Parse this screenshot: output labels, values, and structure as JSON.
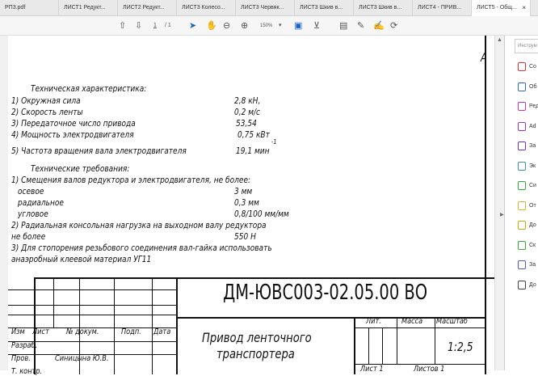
{
  "tabs": [
    "РП3.pdf",
    "ЛИСТ1 Редукт...",
    "ЛИСТ2 Редукт...",
    "ЛИСТ3 Колесо...",
    "ЛИСТ3 Червяк...",
    "ЛИСТ3 Шкив в...",
    "ЛИСТ3 Шкив в...",
    "ЛИСТ4 - ПРИВ...",
    "ЛИСТ5 - Общ..."
  ],
  "toolbar": {
    "page": "1",
    "total": "/ 1",
    "zoom": "150%"
  },
  "panel": {
    "search_placeholder": "Инструм",
    "tools": [
      "Со",
      "Об",
      "Ред",
      "Ad",
      "За",
      "Эк",
      "Си",
      "От",
      "До",
      "Ск",
      "За",
      "До"
    ],
    "tool_colors": [
      "#d33",
      "#36c",
      "#c3a",
      "#93c",
      "#63c",
      "#399",
      "#3a3",
      "#cb2",
      "#ca0",
      "#3a3",
      "#55c",
      "#444"
    ]
  },
  "doc": {
    "corner": "А",
    "tech_title": "Техническая характеристика:",
    "specs": [
      [
        "1) Окружная сила",
        "2,8 кН,"
      ],
      [
        "2) Скорость ленты",
        "0,2 м/с"
      ],
      [
        "3) Передаточное число привода",
        "53,54"
      ],
      [
        "4) Мощность электродвигателя",
        "0,75 кВт"
      ],
      [
        "5) Частота вращения вала электродвигателя",
        "19,1 мин"
      ]
    ],
    "exp": "-1",
    "req_title": "Технические требования:",
    "req": [
      [
        "1) Смещения валов редуктора и электродвигателя, не более:",
        ""
      ],
      [
        "осевое",
        "3 мм"
      ],
      [
        "радиальное",
        "0,3 мм"
      ],
      [
        "угловое",
        "0,8/100 мм/мм"
      ],
      [
        "2) Радиальная консольная нагрузка на выходном валу редуктора",
        ""
      ],
      [
        "не более",
        "550 Н"
      ],
      [
        "3) Для стопорения резьбового соединения вал-гайка использовать",
        ""
      ],
      [
        "анаэробный клеевой материал УГ11",
        ""
      ]
    ],
    "stamp": {
      "code": "ДМ-ЮВС003-02.05.00 ВО",
      "name1": "Привод ленточного",
      "name2": "транспортера",
      "headers": [
        "Изм",
        "Лист",
        "№ докум.",
        "Подп.",
        "Дата"
      ],
      "razrab": "Разраб.",
      "prov": "Пров.",
      "prov_name": "Синицына Ю.В.",
      "tkontr": "Т. контр.",
      "lit": "Лит.",
      "massa": "Масса",
      "masshtab": "Масштаб",
      "scale": "1:2,5",
      "list": "Лист 1",
      "listov": "Листов 1"
    }
  }
}
